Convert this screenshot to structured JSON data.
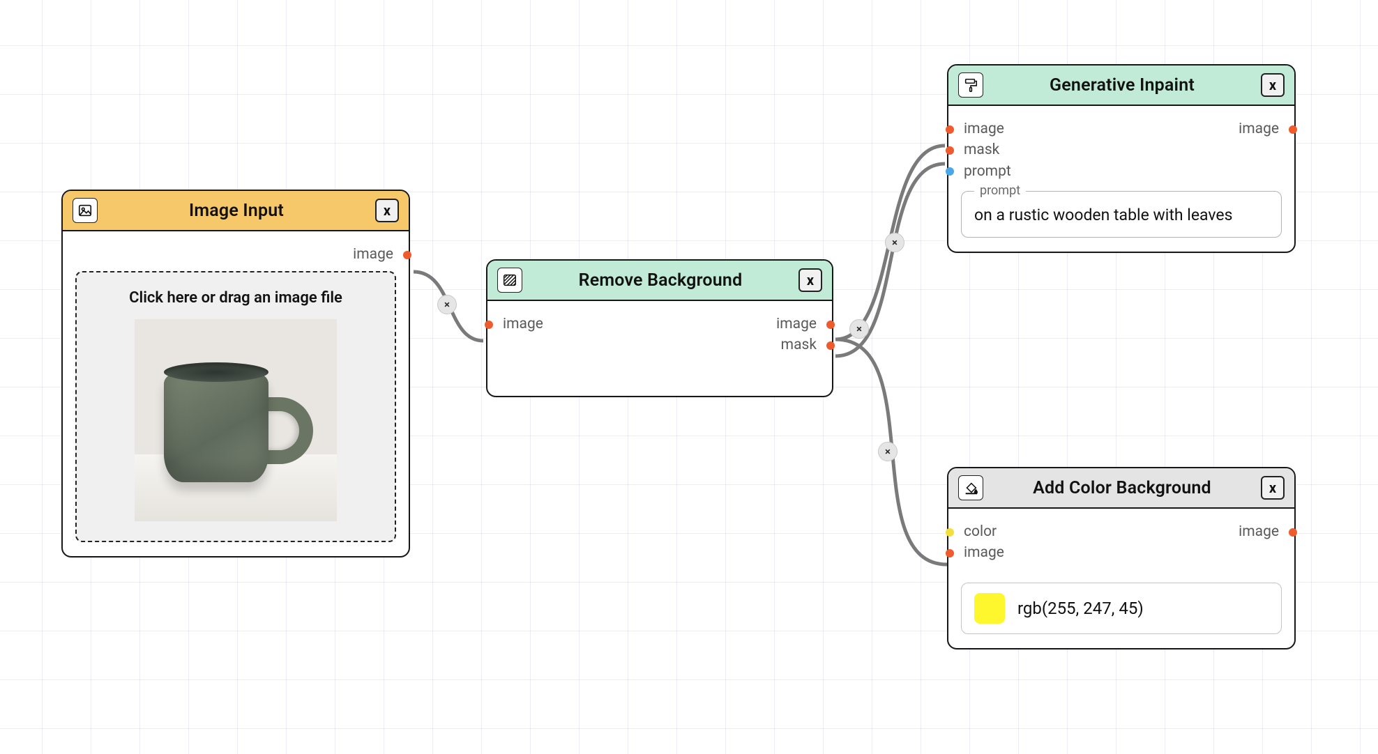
{
  "nodes": {
    "image_input": {
      "title": "Image Input",
      "close": "x",
      "outputs": {
        "image": "image"
      },
      "dropzone_label": "Click here or drag an image file"
    },
    "remove_background": {
      "title": "Remove Background",
      "close": "x",
      "inputs": {
        "image": "image"
      },
      "outputs": {
        "image": "image",
        "mask": "mask"
      }
    },
    "generative_inpaint": {
      "title": "Generative Inpaint",
      "close": "x",
      "inputs": {
        "image": "image",
        "mask": "mask",
        "prompt": "prompt"
      },
      "outputs": {
        "image": "image"
      },
      "field_legend": "prompt",
      "field_value": "on a rustic wooden table with leaves"
    },
    "add_color_background": {
      "title": "Add Color Background",
      "close": "x",
      "inputs": {
        "color": "color",
        "image": "image"
      },
      "outputs": {
        "image": "image"
      },
      "color_hex": "#fff72d",
      "color_text": "rgb(255, 247, 45)"
    }
  },
  "edges": {
    "e1_delete": "×",
    "e2_delete": "×",
    "e3_delete": "×",
    "e4_delete": "×"
  }
}
